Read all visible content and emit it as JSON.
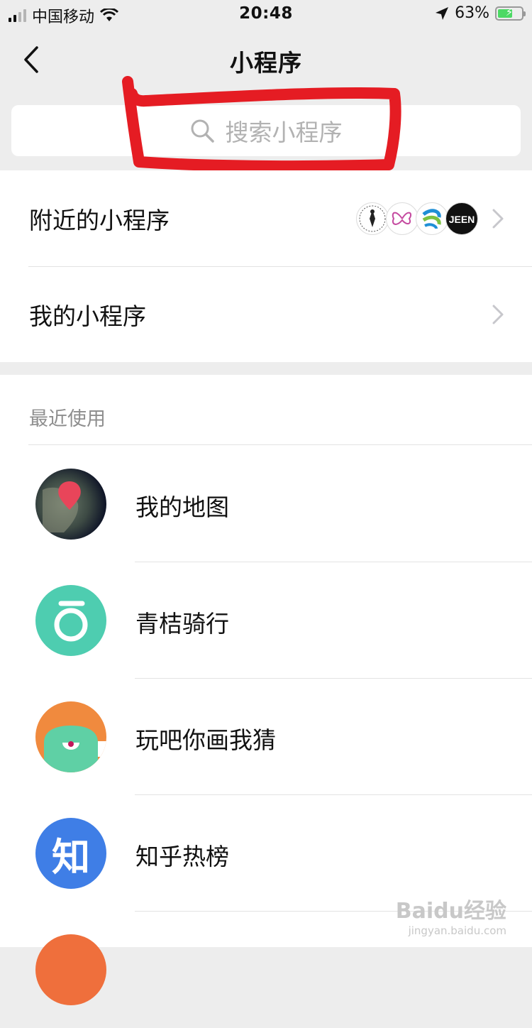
{
  "status": {
    "carrier": "中国移动",
    "time": "20:48",
    "battery": "63%",
    "battery_level": 0.63
  },
  "nav": {
    "title": "小程序"
  },
  "search": {
    "placeholder": "搜索小程序"
  },
  "menu": {
    "nearby": "附近的小程序",
    "mine": "我的小程序"
  },
  "recent": {
    "heading": "最近使用",
    "items": [
      {
        "name": "我的地图",
        "icon": "map-pin-icon"
      },
      {
        "name": "青桔骑行",
        "icon": "qingju-logo-icon"
      },
      {
        "name": "玩吧你画我猜",
        "icon": "draw-guess-logo-icon"
      },
      {
        "name": "知乎热榜",
        "icon": "zhihu-logo-icon",
        "glyph": "知"
      }
    ]
  },
  "colors": {
    "accent_red": "#e51c23",
    "teal": "#4ecdb0",
    "orange": "#f08a3e",
    "zhihu_blue": "#3f7ee6"
  },
  "watermark": {
    "text": "Baidu经验",
    "sub": "jingyan.baidu.com"
  }
}
